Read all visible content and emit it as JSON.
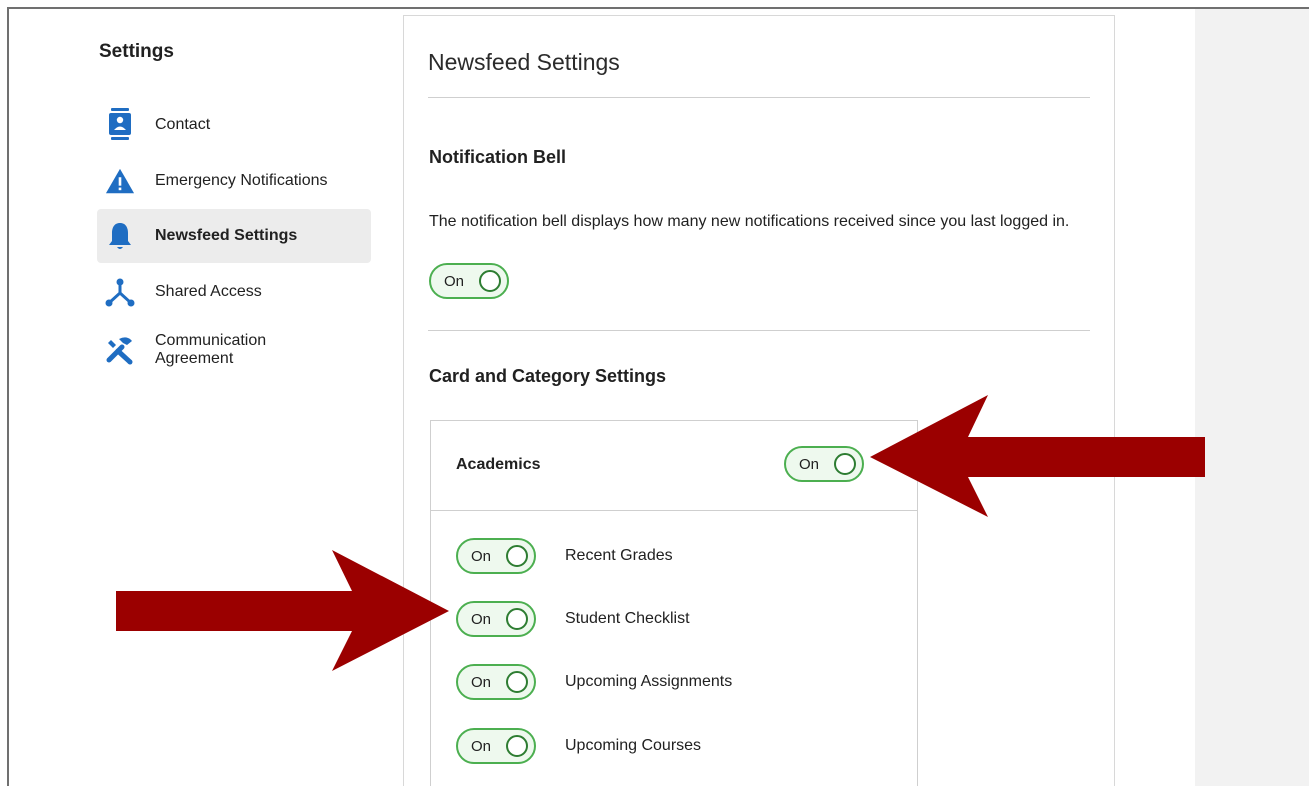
{
  "sidebar": {
    "title": "Settings",
    "items": [
      {
        "label": "Contact",
        "icon": "contact-card-icon"
      },
      {
        "label": "Emergency Notifications",
        "icon": "warning-icon"
      },
      {
        "label": "Newsfeed Settings",
        "icon": "bell-icon",
        "active": true
      },
      {
        "label": "Shared Access",
        "icon": "share-nodes-icon"
      },
      {
        "label": "Communication Agreement",
        "icon": "tools-icon"
      }
    ]
  },
  "main": {
    "title": "Newsfeed Settings",
    "notification_bell": {
      "heading": "Notification Bell",
      "description": "The notification bell displays how many new notifications received since you last logged in.",
      "toggle": "On"
    },
    "card_settings": {
      "heading": "Card and Category Settings",
      "card": {
        "title": "Academics",
        "toggle": "On",
        "items": [
          {
            "label": "Recent Grades",
            "toggle": "On"
          },
          {
            "label": "Student Checklist",
            "toggle": "On"
          },
          {
            "label": "Upcoming Assignments",
            "toggle": "On"
          },
          {
            "label": "Upcoming Courses",
            "toggle": "On"
          }
        ]
      }
    }
  },
  "colors": {
    "accent_blue": "#1f6dc2",
    "toggle_green": "#4caf50",
    "arrow_red": "#9b0000"
  }
}
